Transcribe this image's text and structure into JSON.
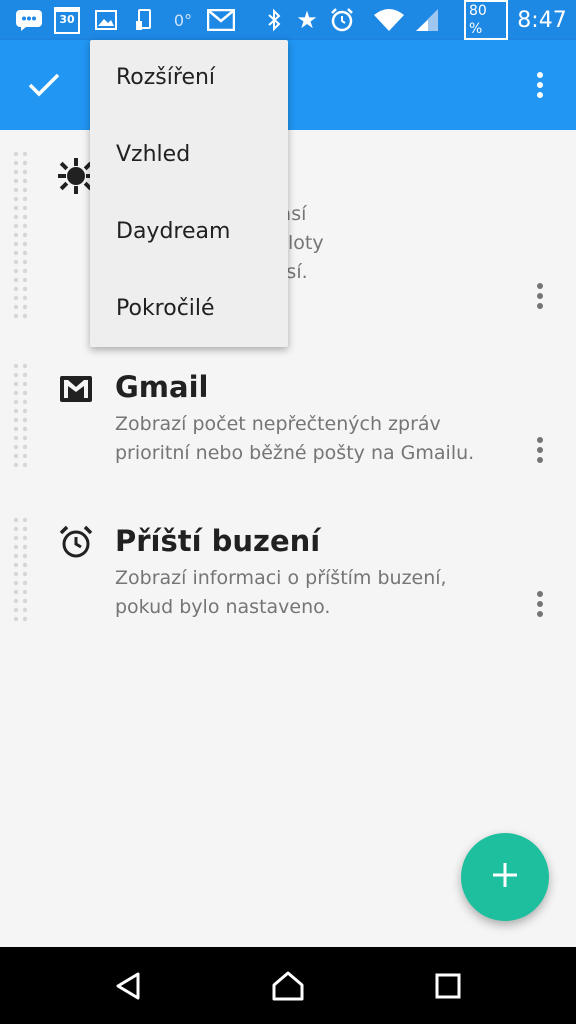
{
  "status_bar": {
    "calendar_day": "30",
    "temperature": "0°",
    "battery": "80 %",
    "time": "8:47"
  },
  "menu": {
    "items": [
      "Rozšíření",
      "Vzhled",
      "Daydream",
      "Pokročilé"
    ]
  },
  "extensions": [
    {
      "title": "",
      "description": "í informace o počasí\nčetně aktuální teploty\né předpověď počasí.\nhoo! Weather.",
      "icon": "weather-sun-icon"
    },
    {
      "title": "Gmail",
      "description": "Zobrazí počet nepřečtených zpráv\nprioritní nebo běžné pošty na Gmailu.",
      "icon": "gmail-icon"
    },
    {
      "title": "Příští buzení",
      "description": "Zobrazí informaci o příštím buzení,\npokud bylo nastaveno.",
      "icon": "alarm-icon"
    }
  ],
  "colors": {
    "status_bar": "#1e88e5",
    "app_bar": "#2196f3",
    "fab": "#1dbf9f"
  }
}
